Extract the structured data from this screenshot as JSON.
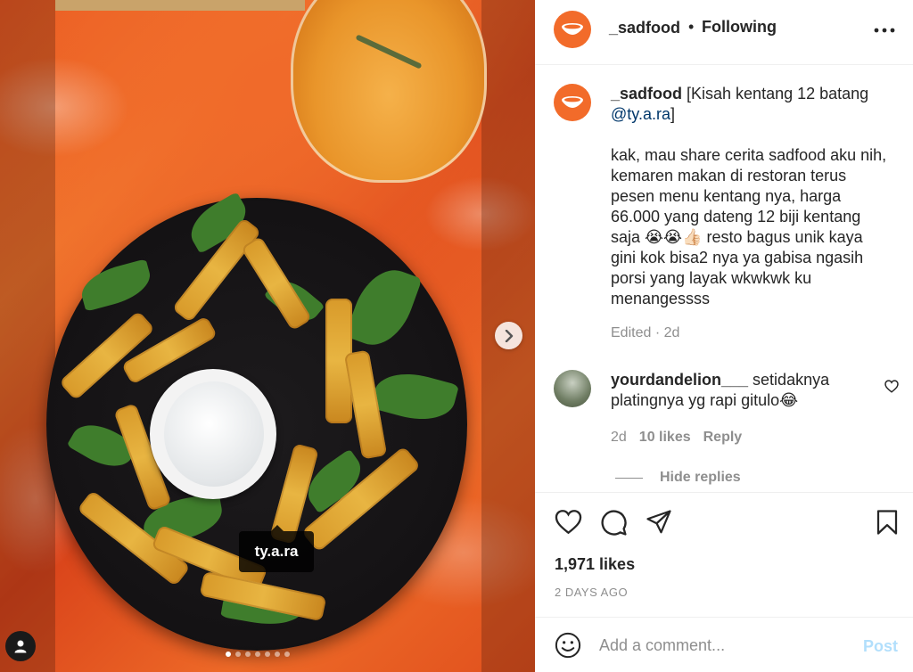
{
  "post": {
    "username": "_sadfood",
    "separator": "•",
    "follow_status": "Following",
    "photo_tag": "ty.a.ra",
    "carousel": {
      "count": 7,
      "active": 1
    }
  },
  "caption": {
    "username": "_sadfood",
    "title_prefix": " [Kisah kentang 12 batang ",
    "mention": "@ty.a.ra",
    "title_suffix": "]",
    "body": "kak, mau share cerita sadfood aku nih, kemaren makan di restoran terus pesen menu kentang nya, harga 66.000 yang dateng 12 biji kentang saja 😭😭👍🏻 resto bagus unik kaya gini kok bisa2 nya ya gabisa ngasih porsi yang layak wkwkwk ku menangessss",
    "meta": "Edited · 2d"
  },
  "comment": {
    "username": "yourdandelion___",
    "text": " setidaknya platingnya yg rapi gitulo😂",
    "age": "2d",
    "likes": "10 likes",
    "reply_label": "Reply",
    "hide_replies_label": "Hide replies"
  },
  "stats": {
    "likes": "1,971 likes",
    "date": "2 DAYS AGO"
  },
  "composer": {
    "placeholder": "Add a comment...",
    "post_label": "Post"
  },
  "colors": {
    "accent_link": "#00376b",
    "post_disabled": "#b2dffc",
    "muted": "#8e8e8e",
    "avatar_bg": "#f26b2a"
  },
  "icons": {
    "header_more": "more-horizontal-icon",
    "like": "heart-icon",
    "comment": "comment-icon",
    "share": "paper-plane-icon",
    "save": "bookmark-icon",
    "emoji": "smiley-icon",
    "next": "chevron-right-icon",
    "user_tags": "user-icon"
  }
}
